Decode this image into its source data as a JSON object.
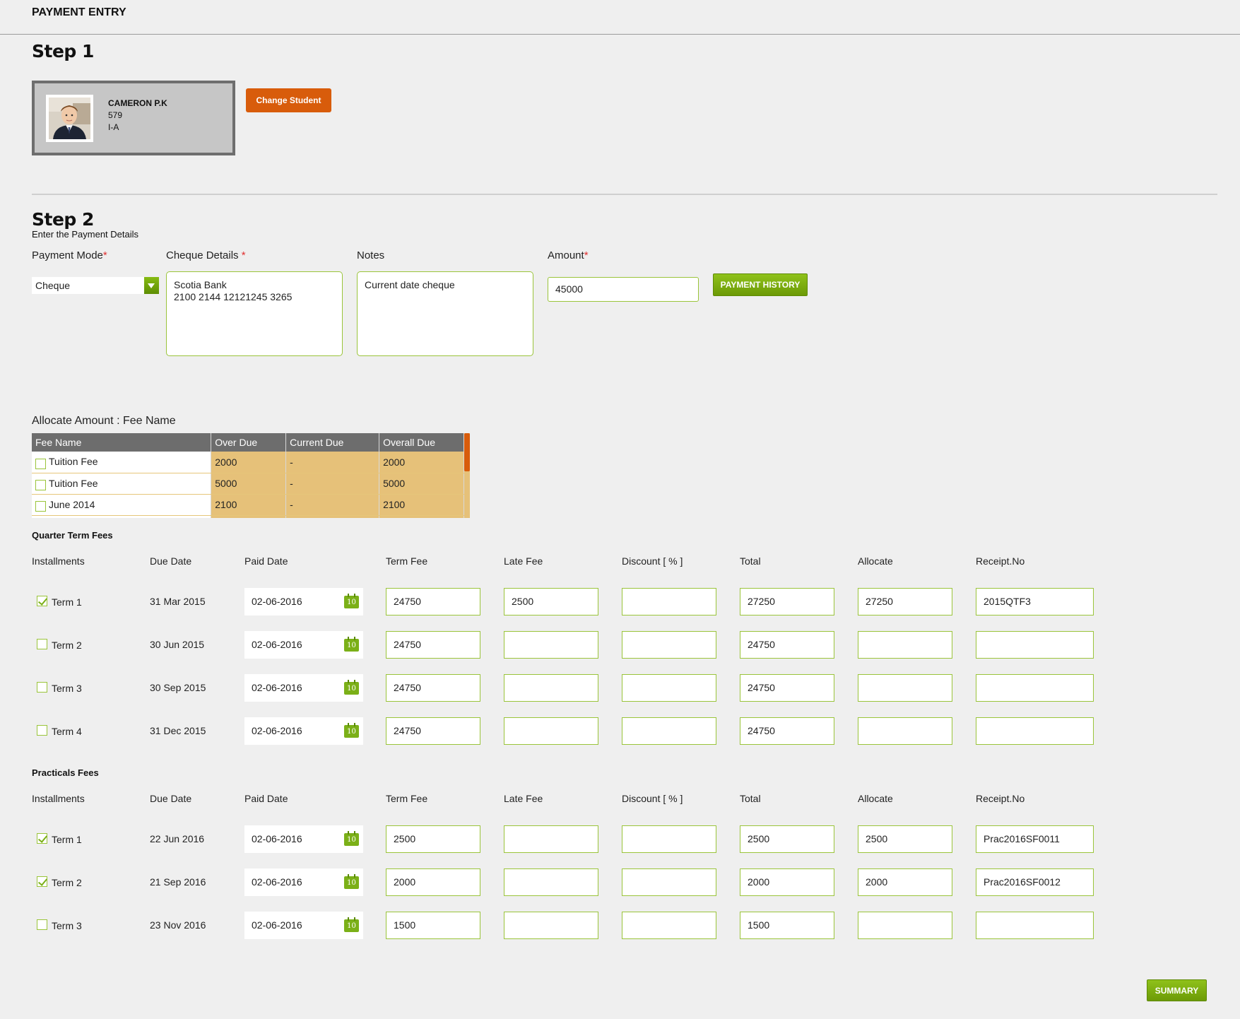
{
  "page": {
    "title": "PAYMENT ENTRY"
  },
  "step1": {
    "heading": "Step 1",
    "student": {
      "name": "CAMERON P.K",
      "id": "579",
      "class": "I-A"
    },
    "change_button": "Change Student"
  },
  "step2": {
    "heading": "Step 2",
    "subtitle": "Enter the Payment Details",
    "payment_mode": {
      "label": "Payment Mode",
      "required": "*",
      "value": "Cheque"
    },
    "cheque_details": {
      "label": "Cheque Details",
      "required": "*",
      "value": "Scotia Bank\n2100 2144 12121245 3265"
    },
    "notes": {
      "label": "Notes",
      "value": "Current date cheque"
    },
    "amount": {
      "label": "Amount",
      "required": "*",
      "value": "45000"
    },
    "history_button": "PAYMENT HISTORY"
  },
  "allocate": {
    "title": "Allocate Amount : Fee Name",
    "columns": [
      "Fee Name",
      "Over Due",
      "Current Due",
      "Overall Due"
    ],
    "rows": [
      {
        "name": "Tuition Fee",
        "over": "2000",
        "current": "-",
        "overall": "2000"
      },
      {
        "name": "Tuition Fee",
        "over": "5000",
        "current": "-",
        "overall": "5000"
      },
      {
        "name": "June 2014",
        "over": "2100",
        "current": "-",
        "overall": "2100"
      }
    ]
  },
  "columns": [
    "Installments",
    "Due Date",
    "Paid Date",
    "Term Fee",
    "Late Fee",
    "Discount [ % ]",
    "Total",
    "Allocate",
    "Receipt.No"
  ],
  "quarter": {
    "title": "Quarter Term Fees",
    "rows": [
      {
        "checked": true,
        "term": "Term 1",
        "due": "31 Mar 2015",
        "paid": "02-06-2016",
        "fee": "24750",
        "late": "2500",
        "discount": "",
        "total": "27250",
        "allocate": "27250",
        "receipt": "2015QTF3"
      },
      {
        "checked": false,
        "term": "Term 2",
        "due": "30 Jun 2015",
        "paid": "02-06-2016",
        "fee": "24750",
        "late": "",
        "discount": "",
        "total": "24750",
        "allocate": "",
        "receipt": ""
      },
      {
        "checked": false,
        "term": "Term 3",
        "due": "30 Sep 2015",
        "paid": "02-06-2016",
        "fee": "24750",
        "late": "",
        "discount": "",
        "total": "24750",
        "allocate": "",
        "receipt": ""
      },
      {
        "checked": false,
        "term": "Term 4",
        "due": "31 Dec 2015",
        "paid": "02-06-2016",
        "fee": "24750",
        "late": "",
        "discount": "",
        "total": "24750",
        "allocate": "",
        "receipt": ""
      }
    ]
  },
  "practicals": {
    "title": "Practicals Fees",
    "rows": [
      {
        "checked": true,
        "term": "Term 1",
        "due": "22 Jun 2016",
        "paid": "02-06-2016",
        "fee": "2500",
        "late": "",
        "discount": "",
        "total": "2500",
        "allocate": "2500",
        "receipt": "Prac2016SF0011"
      },
      {
        "checked": true,
        "term": "Term 2",
        "due": "21 Sep 2016",
        "paid": "02-06-2016",
        "fee": "2000",
        "late": "",
        "discount": "",
        "total": "2000",
        "allocate": "2000",
        "receipt": "Prac2016SF0012"
      },
      {
        "checked": false,
        "term": "Term 3",
        "due": "23 Nov 2016",
        "paid": "02-06-2016",
        "fee": "1500",
        "late": "",
        "discount": "",
        "total": "1500",
        "allocate": "",
        "receipt": ""
      }
    ]
  },
  "calendar_icon_text": "10",
  "summary_button": "SUMMARY"
}
